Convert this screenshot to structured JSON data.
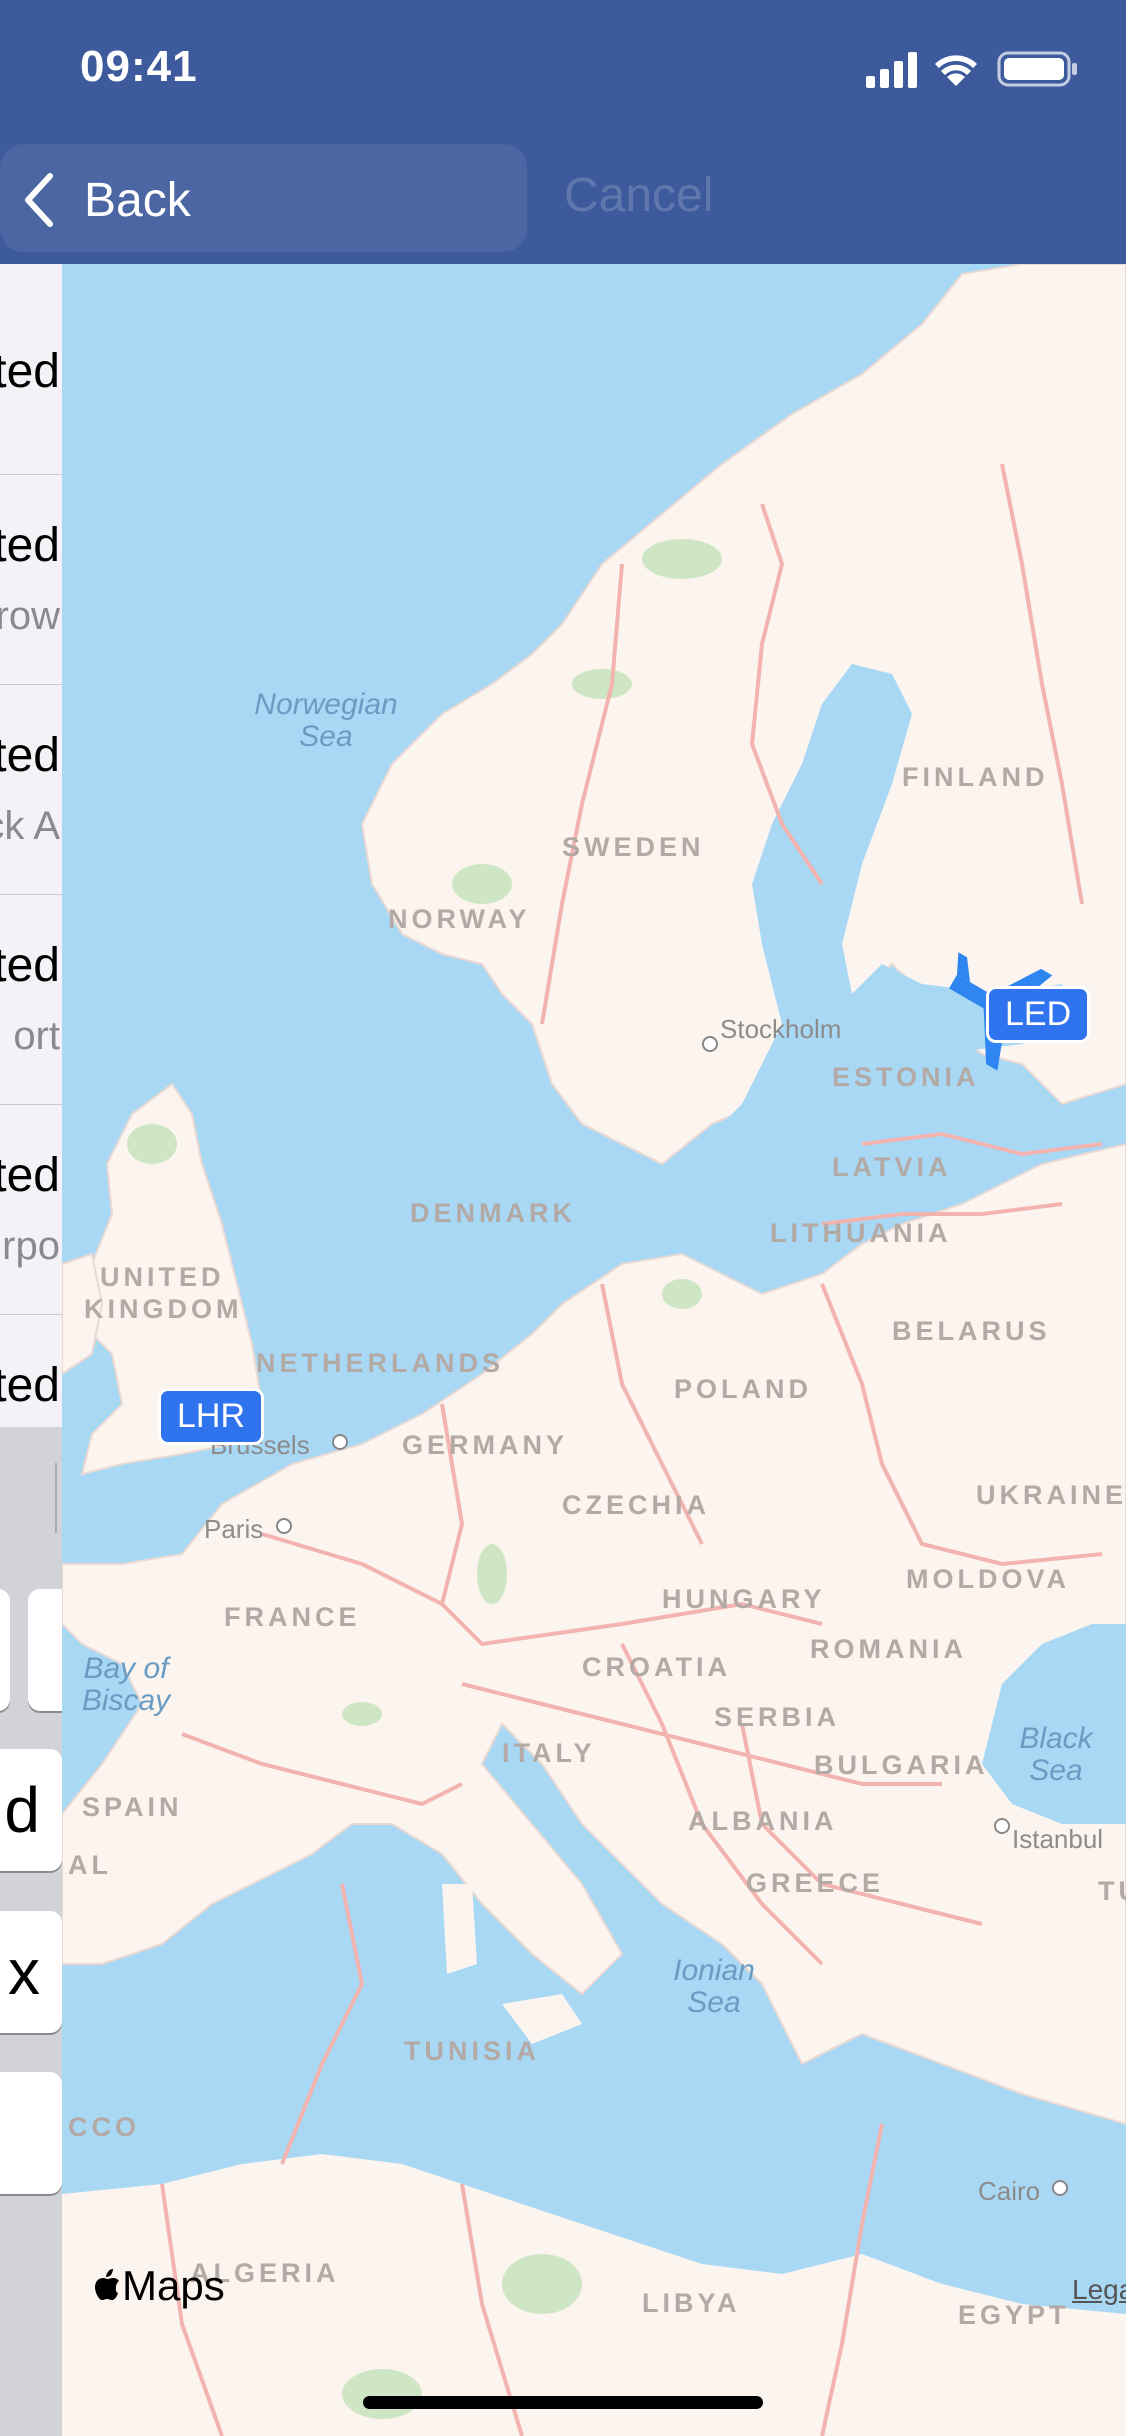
{
  "status_bar": {
    "time": "09:41"
  },
  "nav": {
    "back_label": "Back",
    "cancel_label": "Cancel"
  },
  "list": {
    "rows": [
      {
        "title": "ted",
        "subtitle": ""
      },
      {
        "title": "ted",
        "subtitle": "row"
      },
      {
        "title": "ted",
        "subtitle": "ck A"
      },
      {
        "title": "ted",
        "subtitle": "ort"
      },
      {
        "title": "ted",
        "subtitle": "irpo"
      },
      {
        "title": "ted",
        "subtitle": ""
      }
    ]
  },
  "keyboard": {
    "keys": [
      "",
      "d",
      "x",
      ""
    ]
  },
  "map": {
    "airports": {
      "origin": "LHR",
      "destination": "LED"
    },
    "countries": [
      "FINLAND",
      "SWEDEN",
      "NORWAY",
      "ESTONIA",
      "LATVIA",
      "LITHUANIA",
      "DENMARK",
      "UNITED",
      "KINGDOM",
      "BELARUS",
      "NETHERLANDS",
      "POLAND",
      "GERMANY",
      "UKRAINE",
      "CZECHIA",
      "MOLDOVA",
      "FRANCE",
      "HUNGARY",
      "ROMANIA",
      "CROATIA",
      "SERBIA",
      "BULGARIA",
      "ITALY",
      "SPAIN",
      "ALBANIA",
      "GREECE",
      "TUNISIA",
      "ALGERIA",
      "LIBYA",
      "EGYPT",
      "CCO",
      "AL",
      "TU"
    ],
    "seas": [
      "Norwegian",
      "Sea",
      "Bay of",
      "Biscay",
      "Black",
      "Sea",
      "Ionian",
      "Sea"
    ],
    "cities": [
      "Stockholm",
      "Brussels",
      "Paris",
      "Istanbul",
      "Cairo"
    ],
    "logo": "Maps",
    "legal": "Legal",
    "colors": {
      "water": "#a9d8f5",
      "land": "#fbf4ef",
      "border": "#f3b4b0",
      "forest": "#cfe6c4",
      "route": "#2f86f0"
    }
  }
}
